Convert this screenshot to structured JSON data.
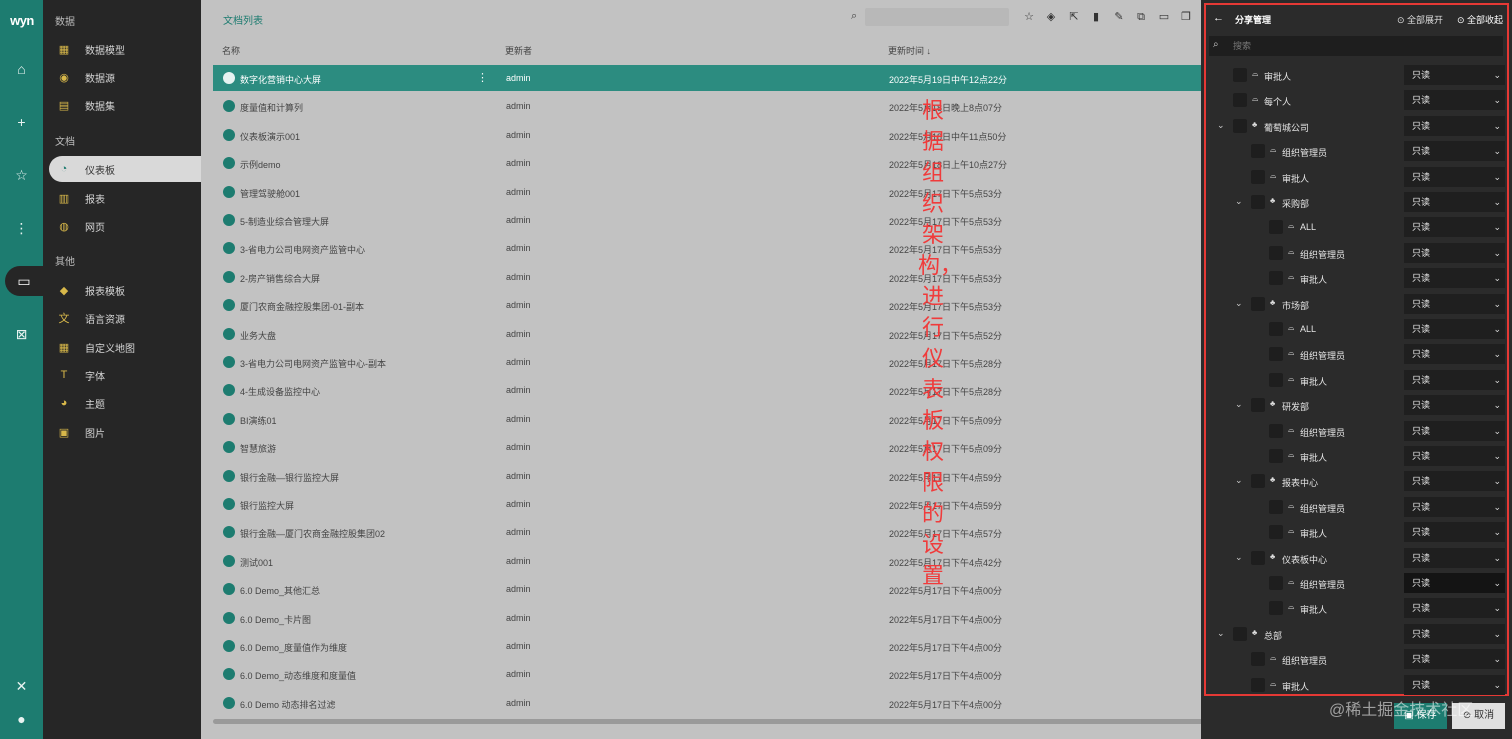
{
  "rail": {
    "logo": "wyn",
    "items": [
      {
        "name": "home-icon",
        "glyph": "⌂"
      },
      {
        "name": "add-icon",
        "glyph": "+"
      },
      {
        "name": "star-icon",
        "glyph": "☆"
      },
      {
        "name": "tree-icon",
        "glyph": "⋮"
      },
      {
        "name": "folder-icon",
        "glyph": "▭"
      },
      {
        "name": "trash-icon",
        "glyph": "🗑"
      },
      {
        "name": "tools-icon",
        "glyph": "✕"
      },
      {
        "name": "user-icon",
        "glyph": "●"
      }
    ]
  },
  "nav": {
    "sections": [
      "数据",
      "文档",
      "其他"
    ],
    "data_items": [
      {
        "label": "数据模型",
        "icon": "▦"
      },
      {
        "label": "数据源",
        "icon": "◉"
      },
      {
        "label": "数据集",
        "icon": "▤"
      }
    ],
    "doc_items": [
      {
        "label": "仪表板",
        "icon": "◔"
      },
      {
        "label": "报表",
        "icon": "▥"
      },
      {
        "label": "网页",
        "icon": "◍"
      }
    ],
    "other_items": [
      {
        "label": "报表模板",
        "icon": "◆"
      },
      {
        "label": "语言资源",
        "icon": "文"
      },
      {
        "label": "自定义地图",
        "icon": "▦"
      },
      {
        "label": "字体",
        "icon": "T"
      },
      {
        "label": "主题",
        "icon": "◕"
      },
      {
        "label": "图片",
        "icon": "▣"
      }
    ]
  },
  "main": {
    "title": "文档列表",
    "toolbar_icons": [
      "star-icon",
      "tag-icon",
      "external-link-icon",
      "delete-icon",
      "edit-icon",
      "copy-icon",
      "present-icon",
      "duplicate-icon"
    ],
    "columns": {
      "name": "名称",
      "owner": "更新者",
      "time": "更新时间 ↓"
    },
    "rows": [
      {
        "name": "数字化营销中心大屏",
        "owner": "admin",
        "time": "2022年5月19日中午12点22分",
        "selected": true
      },
      {
        "name": "度量值和计算列",
        "owner": "admin",
        "time": "2022年5月18日晚上8点07分"
      },
      {
        "name": "仪表板演示001",
        "owner": "admin",
        "time": "2022年5月18日中午11点50分"
      },
      {
        "name": "示例demo",
        "owner": "admin",
        "time": "2022年5月18日上午10点27分"
      },
      {
        "name": "管理驾驶舱001",
        "owner": "admin",
        "time": "2022年5月17日下午5点53分"
      },
      {
        "name": "5-制造业综合管理大屏",
        "owner": "admin",
        "time": "2022年5月17日下午5点53分"
      },
      {
        "name": "3-省电力公司电网资产监管中心",
        "owner": "admin",
        "time": "2022年5月17日下午5点53分"
      },
      {
        "name": "2-房产销售综合大屏",
        "owner": "admin",
        "time": "2022年5月17日下午5点53分"
      },
      {
        "name": "厦门农商金融控股集团-01-副本",
        "owner": "admin",
        "time": "2022年5月17日下午5点53分"
      },
      {
        "name": "业务大盘",
        "owner": "admin",
        "time": "2022年5月17日下午5点52分"
      },
      {
        "name": "3-省电力公司电网资产监管中心-副本",
        "owner": "admin",
        "time": "2022年5月17日下午5点28分"
      },
      {
        "name": "4-生成设备监控中心",
        "owner": "admin",
        "time": "2022年5月17日下午5点28分"
      },
      {
        "name": "BI演练01",
        "owner": "admin",
        "time": "2022年5月17日下午5点09分"
      },
      {
        "name": "智慧旅游",
        "owner": "admin",
        "time": "2022年5月17日下午5点09分"
      },
      {
        "name": "银行金融—银行监控大屏",
        "owner": "admin",
        "time": "2022年5月17日下午4点59分"
      },
      {
        "name": "银行监控大屏",
        "owner": "admin",
        "time": "2022年5月17日下午4点59分"
      },
      {
        "name": "银行金融—厦门农商金融控股集团02",
        "owner": "admin",
        "time": "2022年5月17日下午4点57分"
      },
      {
        "name": "测试001",
        "owner": "admin",
        "time": "2022年5月17日下午4点42分"
      },
      {
        "name": "6.0 Demo_其他汇总",
        "owner": "admin",
        "time": "2022年5月17日下午4点00分"
      },
      {
        "name": "6.0 Demo_卡片图",
        "owner": "admin",
        "time": "2022年5月17日下午4点00分"
      },
      {
        "name": "6.0 Demo_度量值作为维度",
        "owner": "admin",
        "time": "2022年5月17日下午4点00分"
      },
      {
        "name": "6.0 Demo_动态维度和度量值",
        "owner": "admin",
        "time": "2022年5月17日下午4点00分"
      },
      {
        "name": "6.0 Demo 动态排名过滤",
        "owner": "admin",
        "time": "2022年5月17日下午4点00分"
      }
    ]
  },
  "annotation": "根据组织架构，进行仪表板权限的设置",
  "share": {
    "title": "分享管理",
    "expand_all": "全部展开",
    "collapse_all": "全部收起",
    "search_placeholder": "搜索",
    "tree": [
      {
        "label": "审批人",
        "level": 0,
        "type": "role",
        "perm": "只读"
      },
      {
        "label": "每个人",
        "level": 0,
        "type": "role",
        "perm": "只读"
      },
      {
        "label": "葡萄城公司",
        "level": 0,
        "type": "org",
        "perm": "只读",
        "expandable": true
      },
      {
        "label": "组织管理员",
        "level": 1,
        "type": "role",
        "perm": "只读"
      },
      {
        "label": "审批人",
        "level": 1,
        "type": "role",
        "perm": "只读"
      },
      {
        "label": "采购部",
        "level": 1,
        "type": "org",
        "perm": "只读",
        "expandable": true
      },
      {
        "label": "ALL",
        "level": 2,
        "type": "role",
        "perm": "只读"
      },
      {
        "label": "组织管理员",
        "level": 2,
        "type": "role",
        "perm": "只读"
      },
      {
        "label": "审批人",
        "level": 2,
        "type": "role",
        "perm": "只读"
      },
      {
        "label": "市场部",
        "level": 1,
        "type": "org",
        "perm": "只读",
        "expandable": true
      },
      {
        "label": "ALL",
        "level": 2,
        "type": "role",
        "perm": "只读"
      },
      {
        "label": "组织管理员",
        "level": 2,
        "type": "role",
        "perm": "只读"
      },
      {
        "label": "审批人",
        "level": 2,
        "type": "role",
        "perm": "只读"
      },
      {
        "label": "研发部",
        "level": 1,
        "type": "org",
        "perm": "只读",
        "expandable": true
      },
      {
        "label": "组织管理员",
        "level": 2,
        "type": "role",
        "perm": "只读"
      },
      {
        "label": "审批人",
        "level": 2,
        "type": "role",
        "perm": "只读"
      },
      {
        "label": "报表中心",
        "level": 1,
        "type": "org",
        "perm": "只读",
        "expandable": true
      },
      {
        "label": "组织管理员",
        "level": 2,
        "type": "role",
        "perm": "只读"
      },
      {
        "label": "审批人",
        "level": 2,
        "type": "role",
        "perm": "只读"
      },
      {
        "label": "仪表板中心",
        "level": 1,
        "type": "org",
        "perm": "只读",
        "expandable": true
      },
      {
        "label": "组织管理员",
        "level": 2,
        "type": "role",
        "perm": "只读",
        "highlight": true
      },
      {
        "label": "审批人",
        "level": 2,
        "type": "role",
        "perm": "只读"
      },
      {
        "label": "总部",
        "level": 0,
        "type": "org",
        "perm": "只读",
        "expandable": true
      },
      {
        "label": "组织管理员",
        "level": 1,
        "type": "role",
        "perm": "只读"
      },
      {
        "label": "审批人",
        "level": 1,
        "type": "role",
        "perm": "只读"
      }
    ],
    "save_label": "保存",
    "cancel_label": "取消"
  },
  "watermark": "@稀土掘金技术社区",
  "colors": {
    "accent": "#1d7c70",
    "annotation": "#f03b3b",
    "frame": "#e53935"
  }
}
